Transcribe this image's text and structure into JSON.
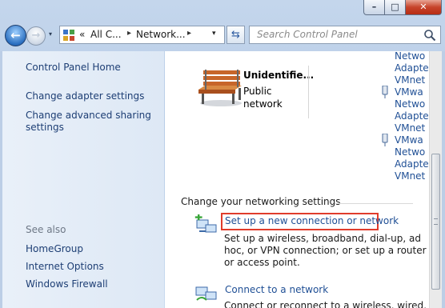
{
  "window": {
    "minimize_glyph": "–",
    "maximize_glyph": "□",
    "close_glyph": "✕"
  },
  "nav": {
    "back_glyph": "←",
    "forward_glyph": "→",
    "recent_glyph": "▾",
    "refresh_glyph": "⇆"
  },
  "address": {
    "chevron": "«",
    "crumb1": "All C...",
    "crumb2": "Network...",
    "separator": "▸",
    "dropdown_glyph": "▾"
  },
  "search": {
    "placeholder": "Search Control Panel"
  },
  "sidebar": {
    "home": "Control Panel Home",
    "tasks": [
      "Change adapter settings",
      "Change advanced sharing",
      "settings"
    ],
    "see_also_title": "See also",
    "see_also": [
      "HomeGroup",
      "Internet Options",
      "Windows Firewall"
    ]
  },
  "network": {
    "name": "Unidentifie...",
    "type_line1": "Public",
    "type_line2": "network"
  },
  "connections": [
    "Netwo",
    "Adapte",
    "VMnet",
    "VMwa",
    "Netwo",
    "Adapte",
    "VMnet",
    "VMwa",
    "Netwo",
    "Adapte",
    "VMnet"
  ],
  "settings": {
    "section_title": "Change your networking settings",
    "setup_link": "Set up a new connection or network",
    "setup_desc": "Set up a wireless, broadband, dial-up, ad hoc, or VPN connection; or set up a router or access point.",
    "connect_link": "Connect to a network",
    "connect_desc": "Connect or reconnect to a wireless, wired,"
  },
  "colors": {
    "link": "#1f4f95",
    "highlight_box": "#e03c2c",
    "sidebar_link": "#1d3e74"
  }
}
